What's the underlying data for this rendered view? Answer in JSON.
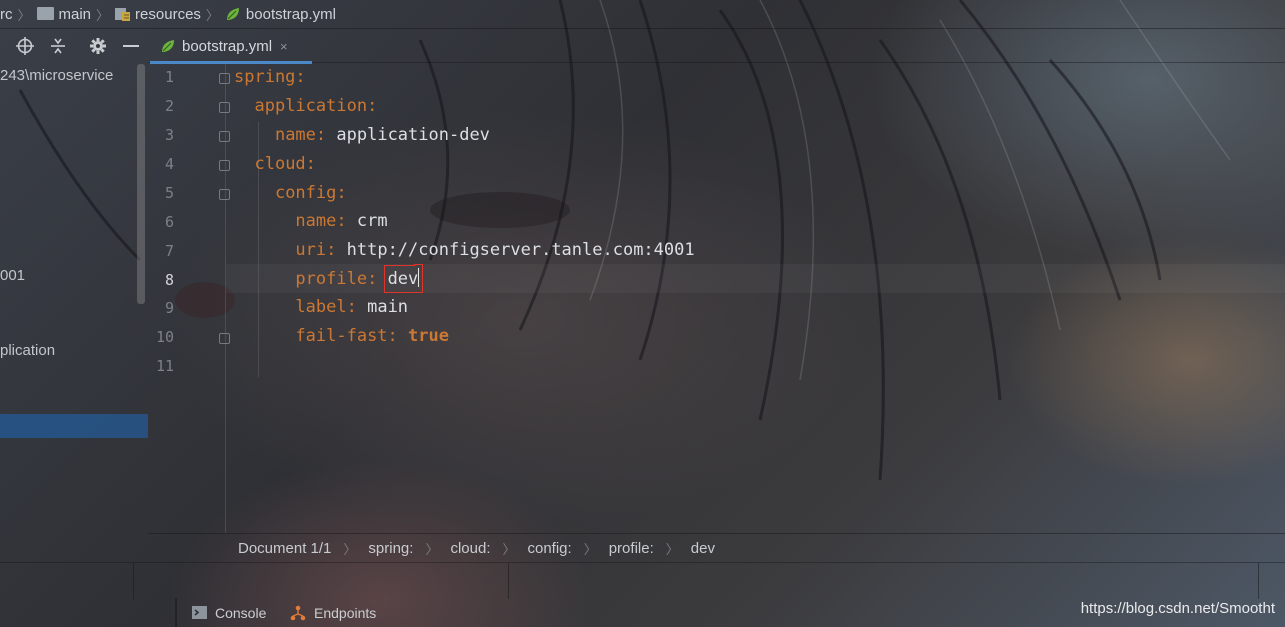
{
  "breadcrumb": {
    "items": [
      {
        "label": "rc",
        "icon": "none"
      },
      {
        "label": "main",
        "icon": "folder-icon"
      },
      {
        "label": "resources",
        "icon": "resources-folder-icon"
      },
      {
        "label": "bootstrap.yml",
        "icon": "spring-leaf-icon"
      }
    ]
  },
  "project_panel": {
    "toolbar": [
      "locate-icon",
      "collapse-icon",
      "gear-icon",
      "minimize-icon"
    ],
    "rows": [
      "243\\microservice",
      "001",
      "plication"
    ]
  },
  "editor": {
    "tab": {
      "label": "bootstrap.yml",
      "close": "×"
    },
    "line_numbers": [
      "1",
      "2",
      "3",
      "4",
      "5",
      "6",
      "7",
      "8",
      "9",
      "10",
      "11"
    ],
    "current_line": "8",
    "lines": [
      {
        "indent": "",
        "key": "spring",
        "colon": ":",
        "value": ""
      },
      {
        "indent": "  ",
        "key": "application",
        "colon": ":",
        "value": ""
      },
      {
        "indent": "    ",
        "key": "name",
        "colon": ": ",
        "value": "application-dev"
      },
      {
        "indent": "  ",
        "key": "cloud",
        "colon": ":",
        "value": ""
      },
      {
        "indent": "    ",
        "key": "config",
        "colon": ":",
        "value": ""
      },
      {
        "indent": "      ",
        "key": "name",
        "colon": ": ",
        "value": "crm"
      },
      {
        "indent": "      ",
        "key": "uri",
        "colon": ": ",
        "value": "http://configserver.tanle.com:4001"
      },
      {
        "indent": "      ",
        "key": "profile",
        "colon": ": ",
        "value": "dev"
      },
      {
        "indent": "      ",
        "key": "label",
        "colon": ": ",
        "value": "main"
      },
      {
        "indent": "      ",
        "key": "fail-fast",
        "colon": ": ",
        "value": "true"
      }
    ],
    "status": {
      "document": "Document 1/1",
      "path": [
        "spring:",
        "cloud:",
        "config:",
        "profile:",
        "dev"
      ]
    }
  },
  "tool_windows": {
    "console": "Console",
    "endpoints": "Endpoints"
  },
  "watermark": "https://blog.csdn.net/Smootht",
  "colors": {
    "key": "#cc7832",
    "value": "#dcdfe3",
    "selection": "#26568c",
    "highlight_box": "#e0342b",
    "tab_underline": "#4a88c7"
  }
}
